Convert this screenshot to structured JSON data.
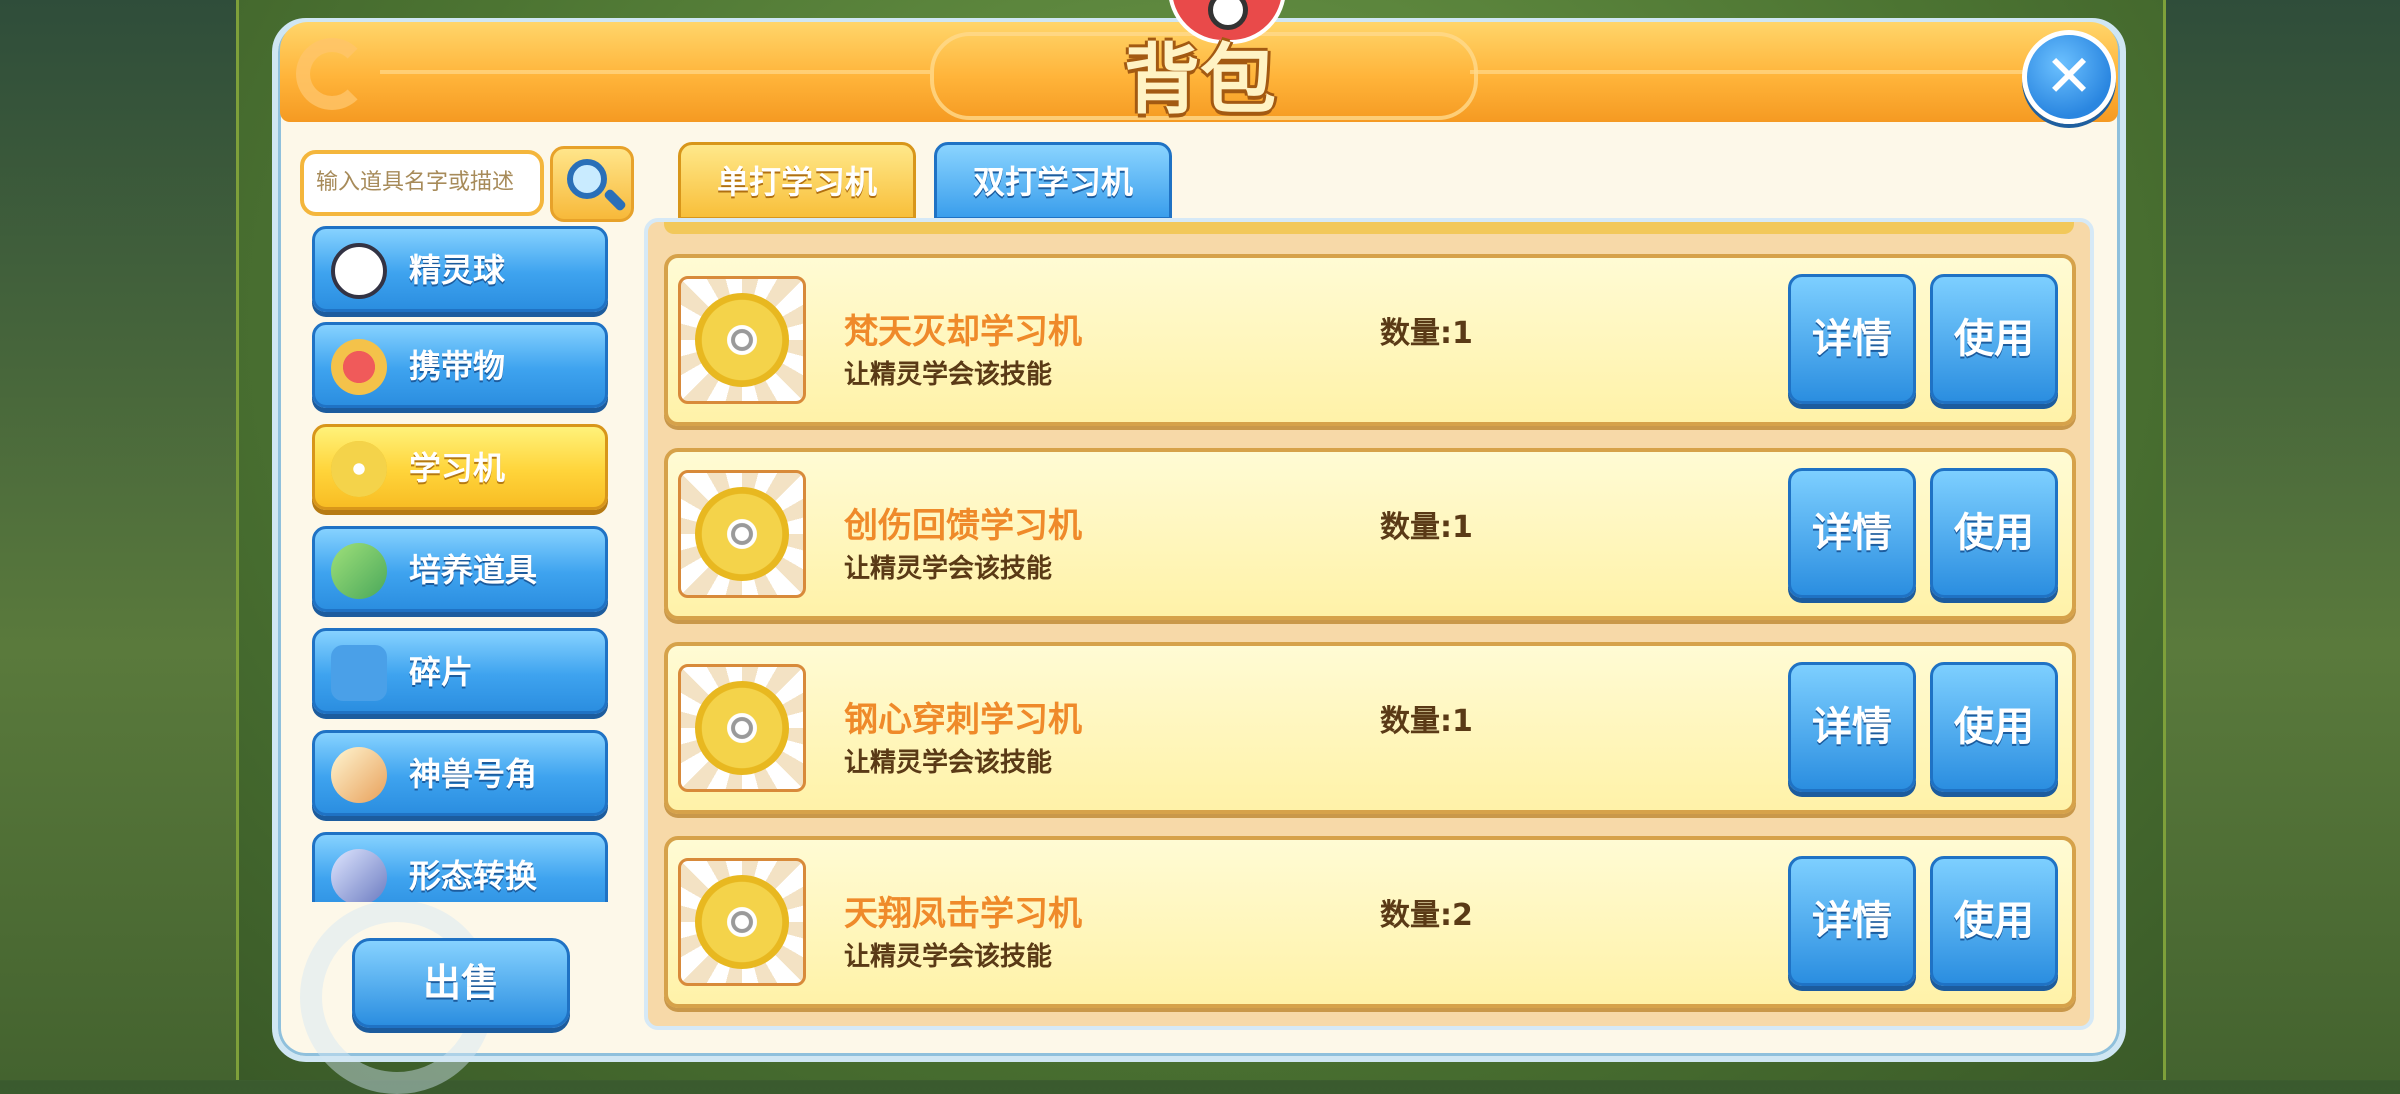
{
  "header": {
    "title": "背包"
  },
  "search": {
    "placeholder": "输入道具名字或描述"
  },
  "categories": [
    {
      "label": "精灵球",
      "icon": "pokeball-icon"
    },
    {
      "label": "携带物",
      "icon": "held-item-icon"
    },
    {
      "label": "学习机",
      "icon": "disc-icon",
      "active": true
    },
    {
      "label": "培养道具",
      "icon": "training-item-icon"
    },
    {
      "label": "碎片",
      "icon": "puzzle-piece-icon"
    },
    {
      "label": "神兽号角",
      "icon": "horn-icon"
    },
    {
      "label": "形态转换",
      "icon": "form-change-icon"
    }
  ],
  "sell_label": "出售",
  "tabs": [
    {
      "label": "单打学习机",
      "active": true
    },
    {
      "label": "双打学习机",
      "active": false
    }
  ],
  "items": [
    {
      "name": "梵天灭却学习机",
      "desc": "让精灵学会该技能",
      "qty": "数量:1",
      "detail": "详情",
      "use": "使用"
    },
    {
      "name": "创伤回馈学习机",
      "desc": "让精灵学会该技能",
      "qty": "数量:1",
      "detail": "详情",
      "use": "使用"
    },
    {
      "name": "钢心穿刺学习机",
      "desc": "让精灵学会该技能",
      "qty": "数量:1",
      "detail": "详情",
      "use": "使用"
    },
    {
      "name": "天翔凤击学习机",
      "desc": "让精灵学会该技能",
      "qty": "数量:2",
      "detail": "详情",
      "use": "使用"
    }
  ],
  "colors": {
    "accent_orange": "#f59a22",
    "button_blue": "#2b8ee0",
    "active_yellow": "#ffd43a"
  }
}
